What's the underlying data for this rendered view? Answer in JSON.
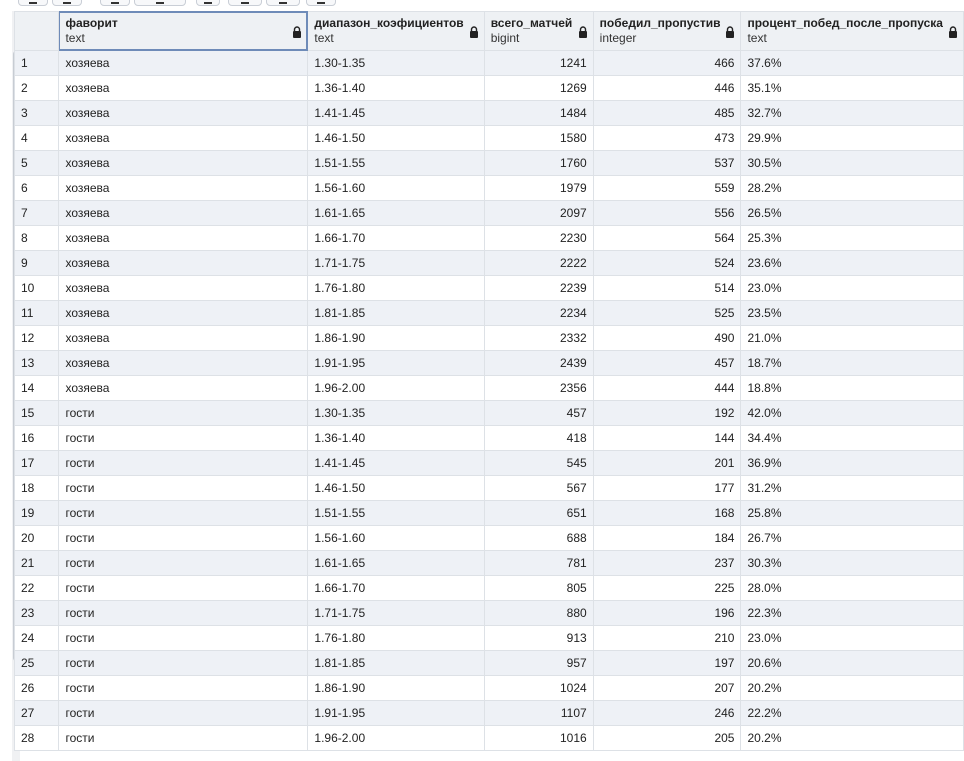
{
  "grid": {
    "columns": [
      {
        "name": "фаворит",
        "type": "text"
      },
      {
        "name": "диапазон_коэфициентов",
        "type": "text"
      },
      {
        "name": "всего_матчей",
        "type": "bigint"
      },
      {
        "name": "победил_пропустив",
        "type": "integer"
      },
      {
        "name": "процент_побед_после_пропуска",
        "type": "text"
      }
    ],
    "column_lock_icon": "lock-icon",
    "rows": [
      {
        "n": "1",
        "fav": "хозяева",
        "range": "1.30-1.35",
        "total": "1241",
        "won": "466",
        "pct": "37.6%"
      },
      {
        "n": "2",
        "fav": "хозяева",
        "range": "1.36-1.40",
        "total": "1269",
        "won": "446",
        "pct": "35.1%"
      },
      {
        "n": "3",
        "fav": "хозяева",
        "range": "1.41-1.45",
        "total": "1484",
        "won": "485",
        "pct": "32.7%"
      },
      {
        "n": "4",
        "fav": "хозяева",
        "range": "1.46-1.50",
        "total": "1580",
        "won": "473",
        "pct": "29.9%"
      },
      {
        "n": "5",
        "fav": "хозяева",
        "range": "1.51-1.55",
        "total": "1760",
        "won": "537",
        "pct": "30.5%"
      },
      {
        "n": "6",
        "fav": "хозяева",
        "range": "1.56-1.60",
        "total": "1979",
        "won": "559",
        "pct": "28.2%"
      },
      {
        "n": "7",
        "fav": "хозяева",
        "range": "1.61-1.65",
        "total": "2097",
        "won": "556",
        "pct": "26.5%"
      },
      {
        "n": "8",
        "fav": "хозяева",
        "range": "1.66-1.70",
        "total": "2230",
        "won": "564",
        "pct": "25.3%"
      },
      {
        "n": "9",
        "fav": "хозяева",
        "range": "1.71-1.75",
        "total": "2222",
        "won": "524",
        "pct": "23.6%"
      },
      {
        "n": "10",
        "fav": "хозяева",
        "range": "1.76-1.80",
        "total": "2239",
        "won": "514",
        "pct": "23.0%"
      },
      {
        "n": "11",
        "fav": "хозяева",
        "range": "1.81-1.85",
        "total": "2234",
        "won": "525",
        "pct": "23.5%"
      },
      {
        "n": "12",
        "fav": "хозяева",
        "range": "1.86-1.90",
        "total": "2332",
        "won": "490",
        "pct": "21.0%"
      },
      {
        "n": "13",
        "fav": "хозяева",
        "range": "1.91-1.95",
        "total": "2439",
        "won": "457",
        "pct": "18.7%"
      },
      {
        "n": "14",
        "fav": "хозяева",
        "range": "1.96-2.00",
        "total": "2356",
        "won": "444",
        "pct": "18.8%"
      },
      {
        "n": "15",
        "fav": "гости",
        "range": "1.30-1.35",
        "total": "457",
        "won": "192",
        "pct": "42.0%"
      },
      {
        "n": "16",
        "fav": "гости",
        "range": "1.36-1.40",
        "total": "418",
        "won": "144",
        "pct": "34.4%"
      },
      {
        "n": "17",
        "fav": "гости",
        "range": "1.41-1.45",
        "total": "545",
        "won": "201",
        "pct": "36.9%"
      },
      {
        "n": "18",
        "fav": "гости",
        "range": "1.46-1.50",
        "total": "567",
        "won": "177",
        "pct": "31.2%"
      },
      {
        "n": "19",
        "fav": "гости",
        "range": "1.51-1.55",
        "total": "651",
        "won": "168",
        "pct": "25.8%"
      },
      {
        "n": "20",
        "fav": "гости",
        "range": "1.56-1.60",
        "total": "688",
        "won": "184",
        "pct": "26.7%"
      },
      {
        "n": "21",
        "fav": "гости",
        "range": "1.61-1.65",
        "total": "781",
        "won": "237",
        "pct": "30.3%"
      },
      {
        "n": "22",
        "fav": "гости",
        "range": "1.66-1.70",
        "total": "805",
        "won": "225",
        "pct": "28.0%"
      },
      {
        "n": "23",
        "fav": "гости",
        "range": "1.71-1.75",
        "total": "880",
        "won": "196",
        "pct": "22.3%"
      },
      {
        "n": "24",
        "fav": "гости",
        "range": "1.76-1.80",
        "total": "913",
        "won": "210",
        "pct": "23.0%"
      },
      {
        "n": "25",
        "fav": "гости",
        "range": "1.81-1.85",
        "total": "957",
        "won": "197",
        "pct": "20.6%"
      },
      {
        "n": "26",
        "fav": "гости",
        "range": "1.86-1.90",
        "total": "1024",
        "won": "207",
        "pct": "20.2%"
      },
      {
        "n": "27",
        "fav": "гости",
        "range": "1.91-1.95",
        "total": "1107",
        "won": "246",
        "pct": "22.2%"
      },
      {
        "n": "28",
        "fav": "гости",
        "range": "1.96-2.00",
        "total": "1016",
        "won": "205",
        "pct": "20.2%"
      }
    ]
  }
}
